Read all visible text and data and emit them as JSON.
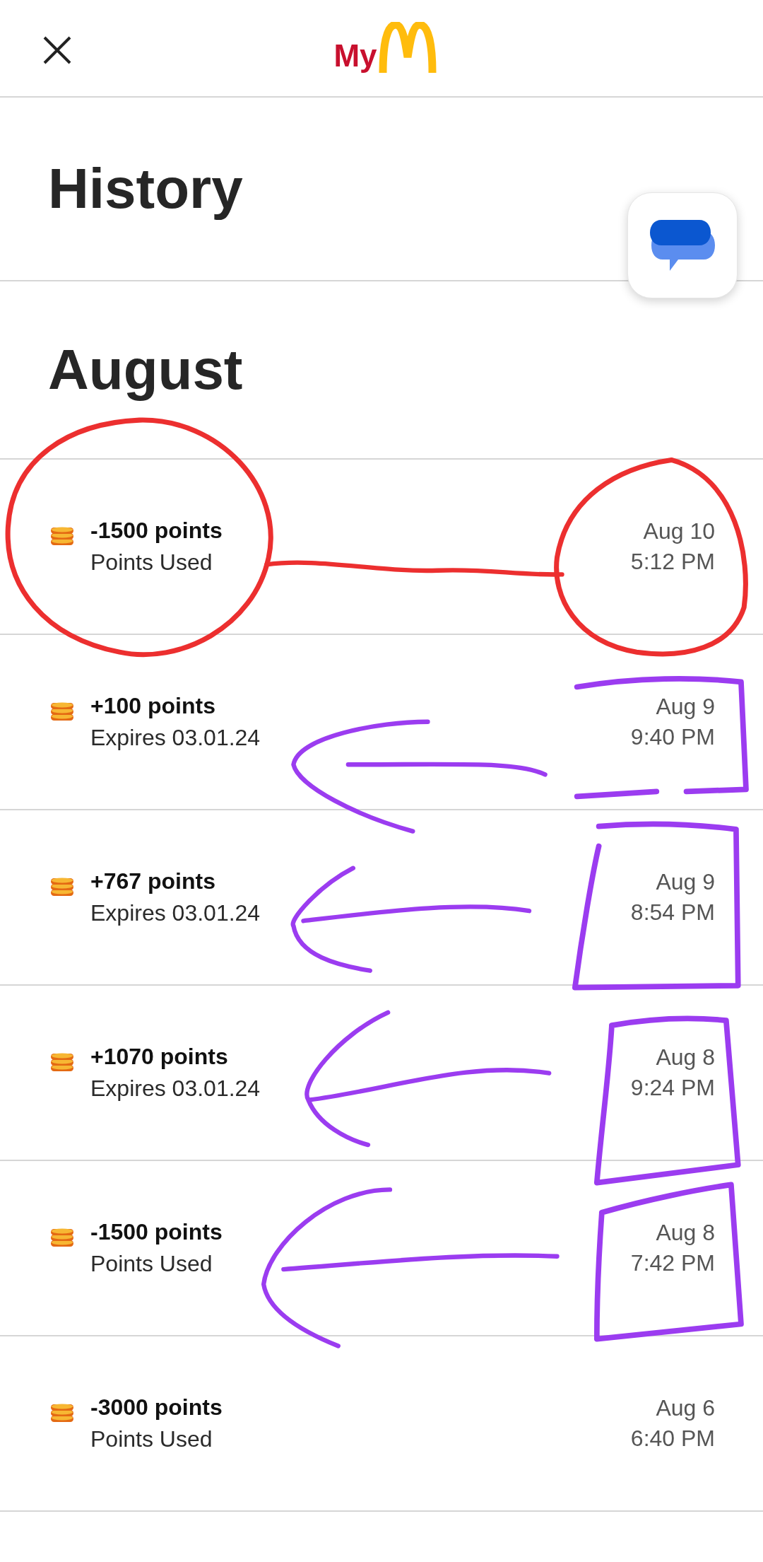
{
  "header": {
    "logo_text": "My"
  },
  "title": "History",
  "section": "August",
  "entries": [
    {
      "points": "-1500 points",
      "detail": "Points Used",
      "date": "Aug 10",
      "time": "5:12 PM"
    },
    {
      "points": "+100 points",
      "detail": "Expires 03.01.24",
      "date": "Aug 9",
      "time": "9:40 PM"
    },
    {
      "points": "+767 points",
      "detail": "Expires 03.01.24",
      "date": "Aug 9",
      "time": "8:54 PM"
    },
    {
      "points": "+1070 points",
      "detail": "Expires 03.01.24",
      "date": "Aug 8",
      "time": "9:24 PM"
    },
    {
      "points": "-1500 points",
      "detail": "Points Used",
      "date": "Aug 8",
      "time": "7:42 PM"
    },
    {
      "points": "-3000 points",
      "detail": "Points Used",
      "date": "Aug 6",
      "time": "6:40 PM"
    }
  ],
  "annotations": [
    {
      "kind": "circle",
      "color": "#ec2f2f"
    },
    {
      "kind": "line",
      "color": "#ec2f2f"
    },
    {
      "kind": "circle",
      "color": "#ec2f2f"
    },
    {
      "kind": "arrow",
      "color": "#9b3cf0"
    },
    {
      "kind": "box",
      "color": "#9b3cf0"
    },
    {
      "kind": "arrow",
      "color": "#9b3cf0"
    },
    {
      "kind": "box",
      "color": "#9b3cf0"
    },
    {
      "kind": "arrow",
      "color": "#9b3cf0"
    },
    {
      "kind": "box",
      "color": "#9b3cf0"
    },
    {
      "kind": "arrow",
      "color": "#9b3cf0"
    },
    {
      "kind": "box",
      "color": "#9b3cf0"
    }
  ]
}
